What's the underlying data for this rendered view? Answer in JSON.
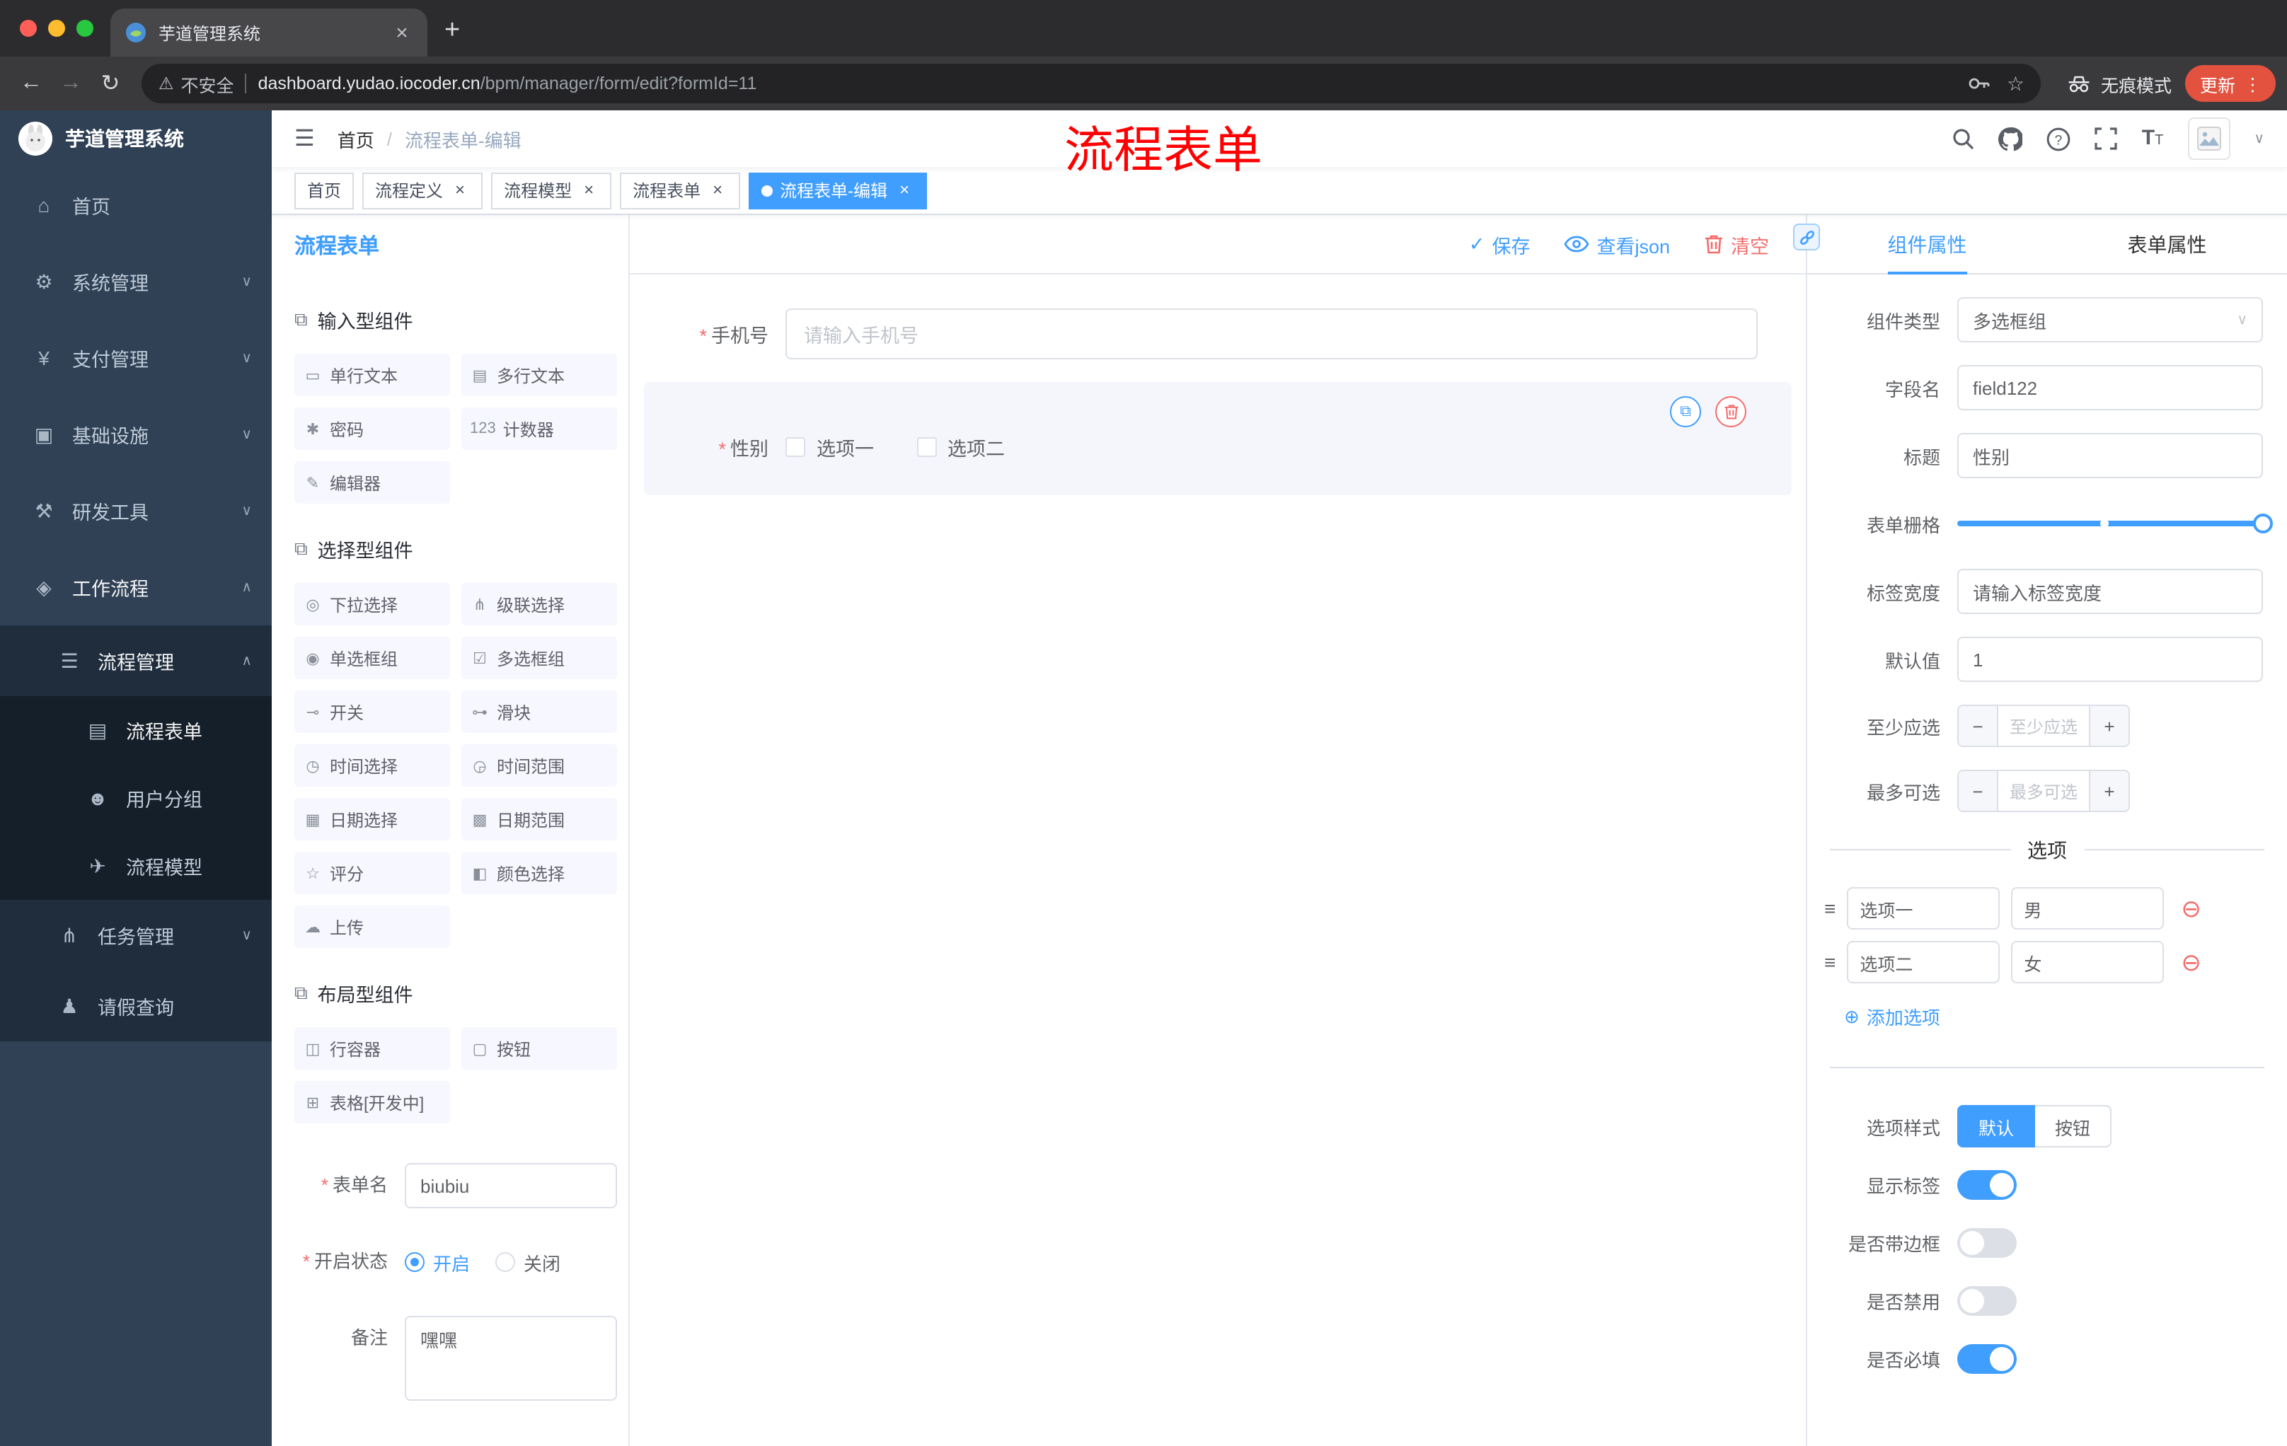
{
  "browser": {
    "tab_title": "芋道管理系统",
    "security_label": "不安全",
    "url_host": "dashboard.yudao.iocoder.cn",
    "url_path": "/bpm/manager/form/edit?formId=11",
    "incognito_label": "无痕模式",
    "update_label": "更新"
  },
  "annotation": {
    "text": "流程表单"
  },
  "header": {
    "breadcrumb_root": "首页",
    "breadcrumb_current": "流程表单-编辑"
  },
  "tags": [
    {
      "label": "首页"
    },
    {
      "label": "流程定义"
    },
    {
      "label": "流程模型"
    },
    {
      "label": "流程表单"
    },
    {
      "label": "流程表单-编辑"
    }
  ],
  "sidebar": {
    "title": "芋道管理系统",
    "items": [
      {
        "label": "首页",
        "glyph": "⌂"
      },
      {
        "label": "系统管理",
        "glyph": "⚙"
      },
      {
        "label": "支付管理",
        "glyph": "¥"
      },
      {
        "label": "基础设施",
        "glyph": "▣"
      },
      {
        "label": "研发工具",
        "glyph": "⚒"
      },
      {
        "label": "工作流程",
        "glyph": "◈"
      },
      {
        "label": "流程管理",
        "glyph": "☰"
      },
      {
        "label": "流程表单",
        "glyph": "▤"
      },
      {
        "label": "用户分组",
        "glyph": "☻"
      },
      {
        "label": "流程模型",
        "glyph": "✈"
      },
      {
        "label": "任务管理",
        "glyph": "⋔"
      },
      {
        "label": "请假查询",
        "glyph": "♟"
      }
    ]
  },
  "designer": {
    "title": "流程表单",
    "save": "保存",
    "view_json": "查看json",
    "clear": "清空"
  },
  "palette": {
    "sections": [
      {
        "title": "输入型组件",
        "items": [
          {
            "label": "单行文本",
            "glyph": "▭"
          },
          {
            "label": "多行文本",
            "glyph": "▤"
          },
          {
            "label": "密码",
            "glyph": "✱"
          },
          {
            "label": "计数器",
            "glyph": "123"
          },
          {
            "label": "编辑器",
            "glyph": "✎"
          }
        ]
      },
      {
        "title": "选择型组件",
        "items": [
          {
            "label": "下拉选择",
            "glyph": "◎"
          },
          {
            "label": "级联选择",
            "glyph": "⋔"
          },
          {
            "label": "单选框组",
            "glyph": "◉"
          },
          {
            "label": "多选框组",
            "glyph": "☑"
          },
          {
            "label": "开关",
            "glyph": "⊸"
          },
          {
            "label": "滑块",
            "glyph": "⊶"
          },
          {
            "label": "时间选择",
            "glyph": "◷"
          },
          {
            "label": "时间范围",
            "glyph": "◶"
          },
          {
            "label": "日期选择",
            "glyph": "▦"
          },
          {
            "label": "日期范围",
            "glyph": "▩"
          },
          {
            "label": "评分",
            "glyph": "☆"
          },
          {
            "label": "颜色选择",
            "glyph": "◧"
          },
          {
            "label": "上传",
            "glyph": "☁"
          }
        ]
      },
      {
        "title": "布局型组件",
        "items": [
          {
            "label": "行容器",
            "glyph": "◫"
          },
          {
            "label": "按钮",
            "glyph": "▢"
          },
          {
            "label": "表格[开发中]",
            "glyph": "⊞"
          }
        ]
      }
    ]
  },
  "meta_form": {
    "name_label": "表单名",
    "name_value": "biubiu",
    "status_label": "开启状态",
    "status_on": "开启",
    "status_off": "关闭",
    "remark_label": "备注",
    "remark_value": "嘿嘿"
  },
  "canvas": {
    "phone_label": "手机号",
    "phone_placeholder": "请输入手机号",
    "gender_label": "性别",
    "gender_options": [
      "选项一",
      "选项二"
    ]
  },
  "props": {
    "tab_component": "组件属性",
    "tab_form": "表单属性",
    "type_label": "组件类型",
    "type_value": "多选框组",
    "field_label": "字段名",
    "field_value": "field122",
    "title_label": "标题",
    "title_value": "性别",
    "grid_label": "表单栅格",
    "label_width_label": "标签宽度",
    "label_width_placeholder": "请输入标签宽度",
    "default_label": "默认值",
    "default_value": "1",
    "min_label": "至少应选",
    "min_placeholder": "至少应选",
    "max_label": "最多可选",
    "max_placeholder": "最多可选",
    "options_title": "选项",
    "options": [
      {
        "label": "选项一",
        "value": "男"
      },
      {
        "label": "选项二",
        "value": "女"
      }
    ],
    "add_option": "添加选项",
    "style_label": "选项样式",
    "style_default": "默认",
    "style_button": "按钮",
    "switch_show_label": "显示标签",
    "switch_border": "是否带边框",
    "switch_disabled": "是否禁用",
    "switch_required": "是否必填"
  },
  "icons": {
    "chevron_down": "∨",
    "chevron_up": "∧",
    "close": "×",
    "check": "✓",
    "copy": "⧉",
    "remove_circle": "⊖",
    "add_circle": "⊕",
    "drag": "≡",
    "minus": "−",
    "plus": "+",
    "required_star": "*",
    "breadcrumb_sep": "/",
    "back": "←",
    "forward": "→",
    "reload": "↻",
    "warning": "⚠",
    "new_tab": "+",
    "kebab": "⋮",
    "hamburger": "☰",
    "section_cube": "⧉",
    "select_caret": "∨",
    "text_size": "T"
  },
  "colors": {
    "primary": "#409EFF",
    "danger": "#F56C6C",
    "annotation": "#FF0000",
    "sidebar_bg": "#304156",
    "submenu_bg": "#1F2D3D",
    "active_tag_bg": "#409EFF",
    "update_button_bg": "#E2523F"
  }
}
